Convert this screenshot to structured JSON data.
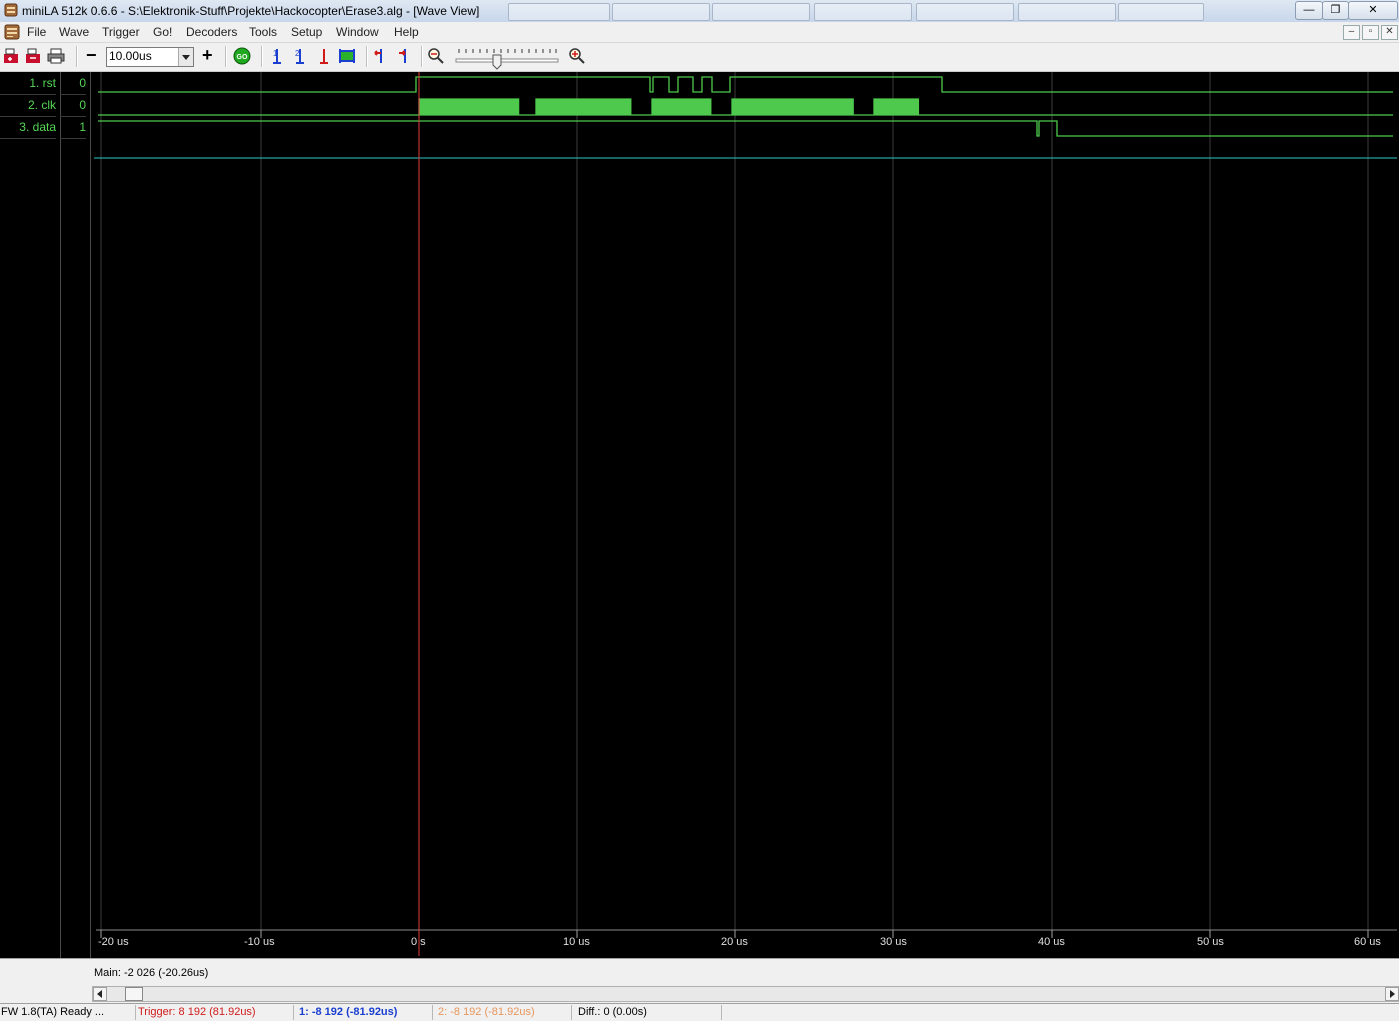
{
  "window": {
    "title": "miniLA 512k 0.6.6 - S:\\Elektronik-Stuff\\Projekte\\Hackocopter\\Erase3.alg - [Wave View]",
    "controls": {
      "minimize": "—",
      "restore": "❐",
      "close": "✕"
    },
    "mdi_controls": {
      "minimize": "–",
      "restore": "▫",
      "close": "✕"
    }
  },
  "menu": [
    "File",
    "Wave",
    "Trigger",
    "Go!",
    "Decoders",
    "Tools",
    "Setup",
    "Window",
    "Help"
  ],
  "toolbar": {
    "zoom_out_label": "−",
    "zoom_value": "10.00us",
    "zoom_in_label": "+",
    "go_label": "GO",
    "icons": [
      "open-icon",
      "save-icon",
      "print-icon",
      "cursor1-icon",
      "cursor2-icon",
      "trigger-cursor-icon",
      "fit-cursors-icon",
      "goto-left-icon",
      "goto-right-icon",
      "zoom-out-icon",
      "zoom-in-icon"
    ]
  },
  "channels": [
    {
      "name": "1. rst",
      "value": "0"
    },
    {
      "name": "2. clk",
      "value": "0"
    },
    {
      "name": "3. data",
      "value": "1"
    }
  ],
  "colors": {
    "signal": "#4ec94e",
    "trigger_cursor": "#e23c3c",
    "marker_line": "#2ec7c7",
    "grid": "#3c3c3c",
    "label_text": "#55d655",
    "tick_text": "#e0e0e0"
  },
  "timeline": {
    "ticks": [
      "-20 us",
      "-10 us",
      "0 s",
      "10 us",
      "20 us",
      "30 us",
      "40 us",
      "50 us",
      "60 us"
    ],
    "main_position": "Main: -2 026  (-20.26us)"
  },
  "status": {
    "fw": "FW 1.8(TA) Ready ...",
    "trigger": "Trigger: 8 192  (81.92us)",
    "cursor1": "1: -8 192  (-81.92us)",
    "cursor2": "2: -8 192  (-81.92us)",
    "diff": "Diff.: 0  (0.00s)"
  }
}
